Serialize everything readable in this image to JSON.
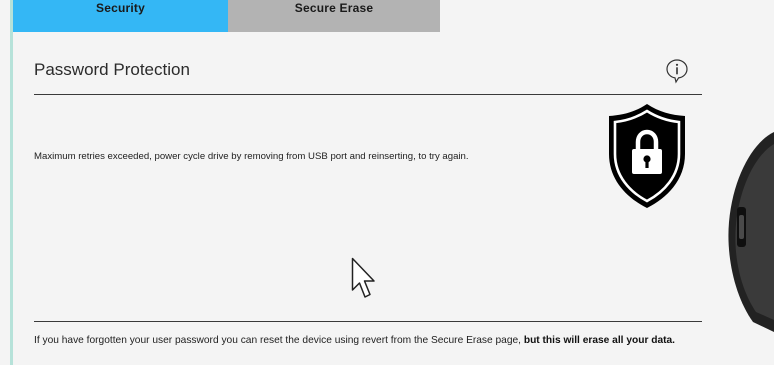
{
  "tabs": [
    {
      "label": "Security",
      "active": true
    },
    {
      "label": "Secure Erase",
      "active": false
    }
  ],
  "panel": {
    "title": "Password Protection",
    "info_icon": "info-icon",
    "status_icon": "shield-lock-icon",
    "status_message": "Maximum retries exceeded, power cycle drive by removing from USB port and reinserting, to try again."
  },
  "help": {
    "text": "If you have forgotten your user password you can reset the device using revert from the Secure Erase page,",
    "warning": "but this will erase all your data."
  },
  "colors": {
    "tab_active": "#34b7f5",
    "tab_inactive": "#b3b3b3",
    "accent_line": "#b6e2d9",
    "background": "#f4f4f4"
  }
}
